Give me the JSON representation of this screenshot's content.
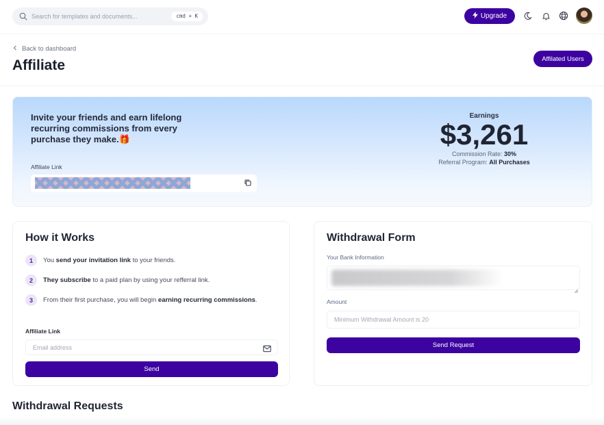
{
  "topbar": {
    "search_placeholder": "Search for templates and documents...",
    "shortcut": "cmd + K",
    "upgrade_label": "Upgrade",
    "icons": [
      "search-icon",
      "bolt-icon",
      "moon-icon",
      "bell-icon",
      "globe-icon",
      "avatar"
    ]
  },
  "header": {
    "back_label": "Back to dashboard",
    "title": "Affiliate",
    "affiliated_users_label": "Affilated Users"
  },
  "hero": {
    "invite_text": "Invite your friends and earn lifelong recurring commissions from every purchase they make.",
    "invite_emoji": "🎁",
    "affiliate_link_label": "Affiliate Link",
    "affiliate_link_value": "[redacted]",
    "earnings_label": "Earnings",
    "earnings_value": "$3,261",
    "commission_label": "Commission Rate:",
    "commission_value": "30%",
    "referral_label": "Referral Program:",
    "referral_value": "All Purchases"
  },
  "how_it_works": {
    "title": "How it Works",
    "steps": [
      {
        "num": "1",
        "pre": "You ",
        "bold": "send your invitation link",
        "post": " to your friends."
      },
      {
        "num": "2",
        "pre": "",
        "bold": "They subscribe",
        "post": " to a paid plan by using your refferral link."
      },
      {
        "num": "3",
        "pre": "From their first purchase, you will begin ",
        "bold": "earning recurring commissions",
        "post": "."
      }
    ],
    "link_label": "Affiliate Link",
    "email_placeholder": "Email address",
    "send_label": "Send"
  },
  "withdrawal_form": {
    "title": "Withdrawal Form",
    "bank_label": "Your Bank Information",
    "bank_value": "[redacted]",
    "amount_label": "Amount",
    "amount_placeholder": "Minimum Withdrawal Amount is 20",
    "submit_label": "Send Request"
  },
  "withdrawal_requests": {
    "title": "Withdrawal Requests"
  },
  "colors": {
    "accent": "#3d03a1",
    "hero_gradient_top": "#b9d8fc",
    "step_badge_bg": "#ece5f8"
  }
}
